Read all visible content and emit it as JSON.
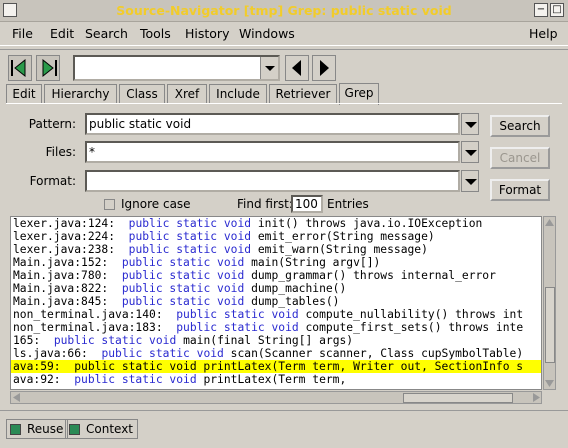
{
  "window": {
    "title": "Source-Navigator [tmp] Grep: public static void",
    "minimize_glyph": "−",
    "close_glyph": "□"
  },
  "menu": [
    "File",
    "Edit",
    "Search",
    "Tools",
    "History",
    "Windows",
    "Help"
  ],
  "toolbar": {
    "location_value": "",
    "icons": [
      "back-green-icon",
      "forward-green-icon",
      "left-arrow-icon",
      "right-arrow-icon"
    ]
  },
  "tabs": [
    "Edit",
    "Hierarchy",
    "Class",
    "Xref",
    "Include",
    "Retriever",
    "Grep"
  ],
  "active_tab": "Grep",
  "grep": {
    "pattern_label": "Pattern:",
    "pattern_value": "public static void",
    "files_label": "Files:",
    "files_value": "*",
    "format_label": "Format:",
    "format_value": "",
    "ignore_case_label": "Ignore case",
    "find_first_label": "Find first:",
    "find_first_value": "100",
    "entries_label": "Entries",
    "search_button": "Search",
    "cancel_button": "Cancel",
    "format_button": "Format"
  },
  "results": [
    {
      "loc": "lexer.java:124:",
      "code": "  public static void init() throws java.io.IOException"
    },
    {
      "loc": "lexer.java:224:",
      "code": "  public static void emit_error(String message)"
    },
    {
      "loc": "lexer.java:238:",
      "code": "  public static void emit_warn(String message)"
    },
    {
      "loc": "Main.java:152:",
      "code": "  public static void main(String argv[])"
    },
    {
      "loc": "Main.java:780:",
      "code": "  public static void dump_grammar() throws internal_error"
    },
    {
      "loc": "Main.java:822:",
      "code": "  public static void dump_machine()"
    },
    {
      "loc": "Main.java:845:",
      "code": "  public static void dump_tables()"
    },
    {
      "loc": "non_terminal.java:140:",
      "code": "  public static void compute_nullability() throws int"
    },
    {
      "loc": "non_terminal.java:183:",
      "code": "  public static void compute_first_sets() throws inte"
    },
    {
      "loc": "165:",
      "code": "  public static void main(final String[] args)"
    },
    {
      "loc": "ls.java:66:",
      "code": "  public static void scan(Scanner scanner, Class cupSymbolTable)"
    },
    {
      "loc": "ava:59:",
      "code": "  public static void printLatex(Term term, Writer out, SectionInfo s"
    },
    {
      "loc": "ava:92:",
      "code": "  public static void printLatex(Term term,"
    }
  ],
  "selected_result_index": 11,
  "status": {
    "reuse_label": "Reuse",
    "context_label": "Context"
  },
  "colors": {
    "title_text": "#f2cc2a",
    "keyword": "#2a2ad0",
    "selection": "#ffff00",
    "checkbox_on": "#2a8a55"
  }
}
